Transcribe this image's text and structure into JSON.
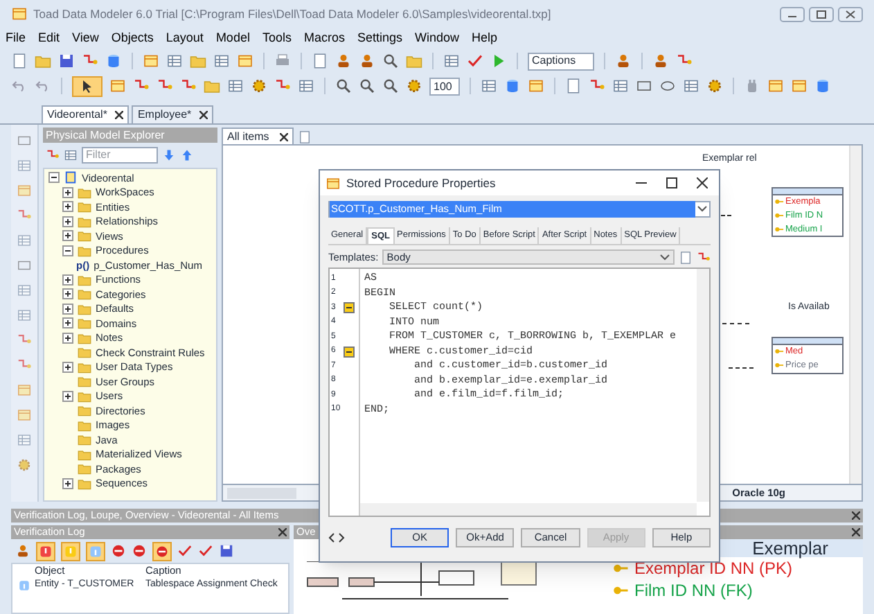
{
  "window": {
    "title": "Toad Data Modeler 6.0 Trial [C:\\Program Files\\Dell\\Toad Data Modeler 6.0\\Samples\\videorental.txp]"
  },
  "menu": [
    "File",
    "Edit",
    "View",
    "Objects",
    "Layout",
    "Model",
    "Tools",
    "Macros",
    "Settings",
    "Window",
    "Help"
  ],
  "toolbar": {
    "captions_dropdown": "Captions",
    "zoom_field": "100",
    "pointer_tool_on": true
  },
  "document_tabs": [
    {
      "label": "Videorental*",
      "selected": true
    },
    {
      "label": "Employee*",
      "selected": false
    }
  ],
  "explorer": {
    "title": "Physical Model Explorer",
    "filter_placeholder": "Filter",
    "tree": [
      {
        "label": "Videorental",
        "expandable": true,
        "expanded": true,
        "children": [
          {
            "label": "WorkSpaces",
            "expandable": true,
            "expanded": false
          },
          {
            "label": "Entities",
            "expandable": true,
            "expanded": false
          },
          {
            "label": "Relationships",
            "expandable": true,
            "expanded": false
          },
          {
            "label": "Views",
            "expandable": true,
            "expanded": false
          },
          {
            "label": "Procedures",
            "expandable": true,
            "expanded": true,
            "children": [
              {
                "label": "p_Customer_Has_Num",
                "icon_text": "p()"
              }
            ]
          },
          {
            "label": "Functions",
            "expandable": true,
            "expanded": false
          },
          {
            "label": "Categories",
            "expandable": true,
            "expanded": false
          },
          {
            "label": "Defaults",
            "expandable": true,
            "expanded": false
          },
          {
            "label": "Domains",
            "expandable": true,
            "expanded": false
          },
          {
            "label": "Notes",
            "expandable": true,
            "expanded": false
          },
          {
            "label": "Check Constraint Rules",
            "expandable": false
          },
          {
            "label": "User Data Types",
            "expandable": true,
            "expanded": false
          },
          {
            "label": "User Groups",
            "expandable": false
          },
          {
            "label": "Users",
            "expandable": true,
            "expanded": false
          },
          {
            "label": "Directories",
            "expandable": false
          },
          {
            "label": "Images",
            "expandable": false
          },
          {
            "label": "Java",
            "expandable": false
          },
          {
            "label": "Materialized Views",
            "expandable": false
          },
          {
            "label": "Packages",
            "expandable": false
          },
          {
            "label": "Sequences",
            "expandable": true,
            "expanded": false
          }
        ]
      }
    ]
  },
  "canvas": {
    "tab": "All items",
    "relation_label": "Exemplar rel",
    "attribute_label": "Is Availab",
    "entities": [
      {
        "rows": [
          {
            "text": "Exempla",
            "kind": "pk"
          },
          {
            "text": "Film ID N",
            "kind": "fk"
          },
          {
            "text": "Medium I",
            "kind": "fk"
          }
        ]
      },
      {
        "rows": [
          {
            "text": "Med",
            "kind": "pk"
          },
          {
            "text": "Price pe",
            "kind": "attr"
          }
        ]
      }
    ],
    "status": "Oracle 10g"
  },
  "dialog": {
    "title": "Stored Procedure Properties",
    "procedure": "SCOTT.p_Customer_Has_Num_Film",
    "highlighted": true,
    "tabs": [
      {
        "label": "General",
        "selected": false
      },
      {
        "label": "SQL",
        "selected": true
      },
      {
        "label": "Permissions",
        "selected": false
      },
      {
        "label": "To Do",
        "selected": false
      },
      {
        "label": "Before Script",
        "selected": false
      },
      {
        "label": "After Script",
        "selected": false
      },
      {
        "label": "Notes",
        "selected": false
      },
      {
        "label": "SQL Preview",
        "selected": false
      }
    ],
    "templates_label": "Templates:",
    "template": "Body",
    "code": [
      {
        "number": "1",
        "text": "AS",
        "fold": false
      },
      {
        "number": "2",
        "text": "BEGIN",
        "fold": false
      },
      {
        "number": "3",
        "text": "    SELECT count(*)",
        "fold": true
      },
      {
        "number": "4",
        "text": "    INTO num",
        "fold": false
      },
      {
        "number": "5",
        "text": "    FROM T_CUSTOMER c, T_BORROWING b, T_EXEMPLAR e",
        "fold": false
      },
      {
        "number": "6",
        "text": "    WHERE c.customer_id=cid",
        "fold": true
      },
      {
        "number": "7",
        "text": "        and c.customer_id=b.customer_id",
        "fold": false
      },
      {
        "number": "8",
        "text": "        and b.exemplar_id=e.exemplar_id",
        "fold": false
      },
      {
        "number": "9",
        "text": "        and e.film_id=f.film_id;",
        "fold": false
      },
      {
        "number": "10",
        "text": "END;",
        "fold": false
      }
    ],
    "buttons": [
      {
        "label": "OK",
        "default": true,
        "disabled": false
      },
      {
        "label": "Ok+Add",
        "default": false,
        "disabled": false
      },
      {
        "label": "Cancel",
        "default": false,
        "disabled": false
      },
      {
        "label": "Apply",
        "default": false,
        "disabled": true
      },
      {
        "label": "Help",
        "default": false,
        "disabled": false
      }
    ]
  },
  "bottom": {
    "title": "Verification Log, Loupe, Overview - Videorental - All Items",
    "verification_log": {
      "title": "Verification Log",
      "filter_toggles": [
        {
          "on": true
        },
        {
          "on": true
        },
        {
          "on": true
        },
        {
          "on": true
        }
      ],
      "columns": [
        "Object",
        "Caption"
      ],
      "rows": [
        [
          "Entity - T_CUSTOMER",
          "Tablespace Assignment Check"
        ]
      ]
    },
    "overview_title": "Ove",
    "entity": {
      "name": "Exemplar",
      "rows": [
        {
          "text": "Exemplar ID NN (PK)",
          "kind": "pk"
        },
        {
          "text": "Film ID NN (FK)",
          "kind": "fk"
        }
      ]
    }
  }
}
